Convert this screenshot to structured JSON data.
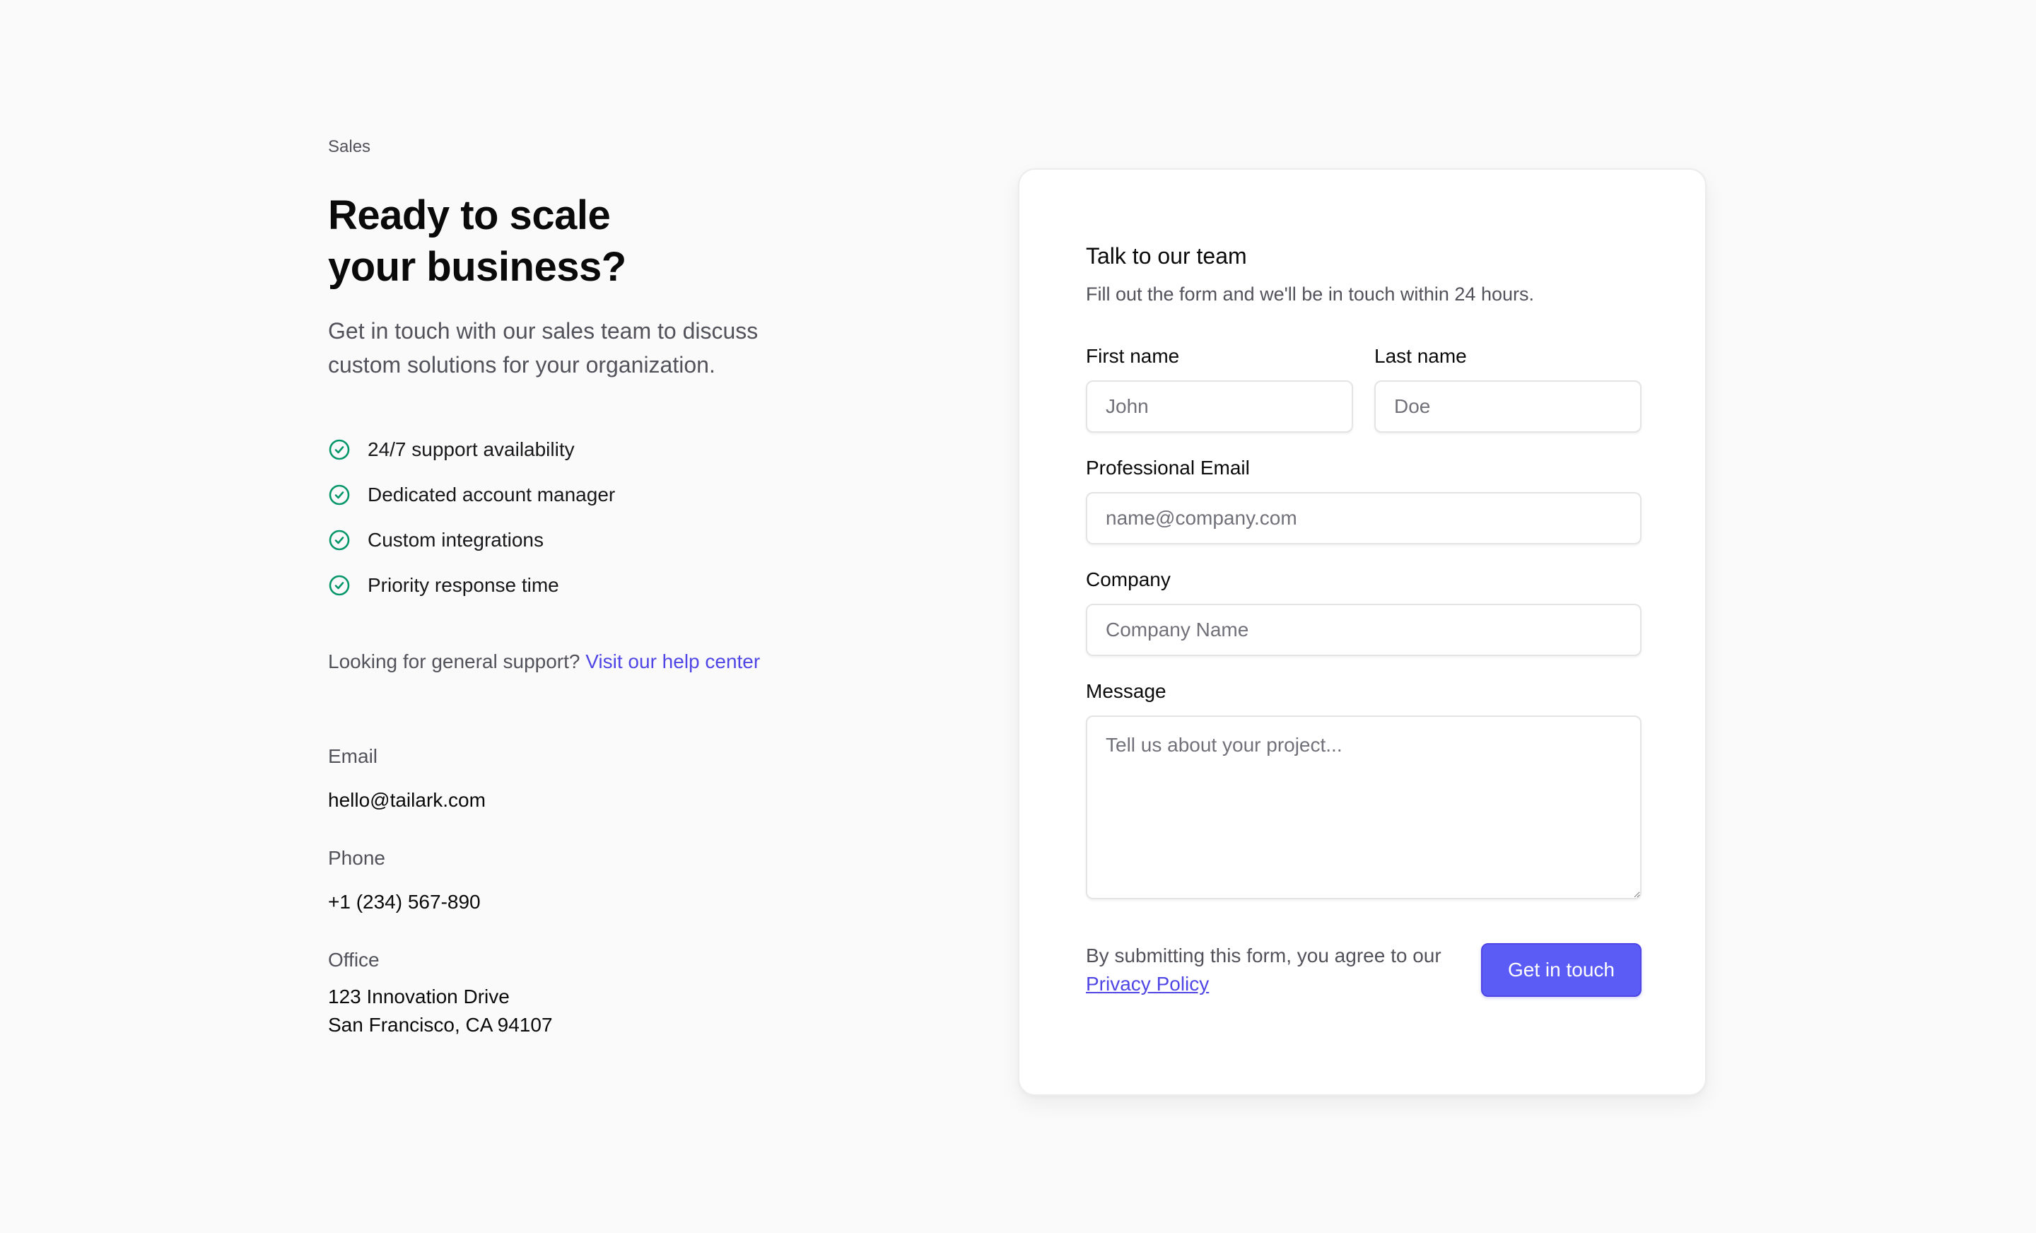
{
  "left": {
    "eyebrow": "Sales",
    "headline_line1": "Ready to scale",
    "headline_line2": "your business?",
    "lede": "Get in touch with our sales team to discuss custom solutions for your organization.",
    "features": [
      "24/7 support availability",
      "Dedicated account manager",
      "Custom integrations",
      "Priority response time"
    ],
    "support_text": "Looking for general support?",
    "support_link": "Visit our help center",
    "contact": {
      "email_label": "Email",
      "email_value": "hello@tailark.com",
      "phone_label": "Phone",
      "phone_value": "+1 (234) 567-890",
      "office_label": "Office",
      "office_line1": "123 Innovation Drive",
      "office_line2": "San Francisco, CA 94107"
    }
  },
  "form": {
    "title": "Talk to our team",
    "subtitle": "Fill out the form and we'll be in touch within 24 hours.",
    "first_name_label": "First name",
    "first_name_placeholder": "John",
    "last_name_label": "Last name",
    "last_name_placeholder": "Doe",
    "email_label": "Professional Email",
    "email_placeholder": "name@company.com",
    "company_label": "Company",
    "company_placeholder": "Company Name",
    "message_label": "Message",
    "message_placeholder": "Tell us about your project...",
    "terms_text": "By submitting this form, you agree to our",
    "terms_link": "Privacy Policy",
    "submit_label": "Get in touch"
  },
  "colors": {
    "background": "#fafafa",
    "accent": "#5b5cf6",
    "link": "#4f46e5",
    "check": "#059669"
  },
  "icons": {
    "feature_check": "check-circle-icon"
  }
}
